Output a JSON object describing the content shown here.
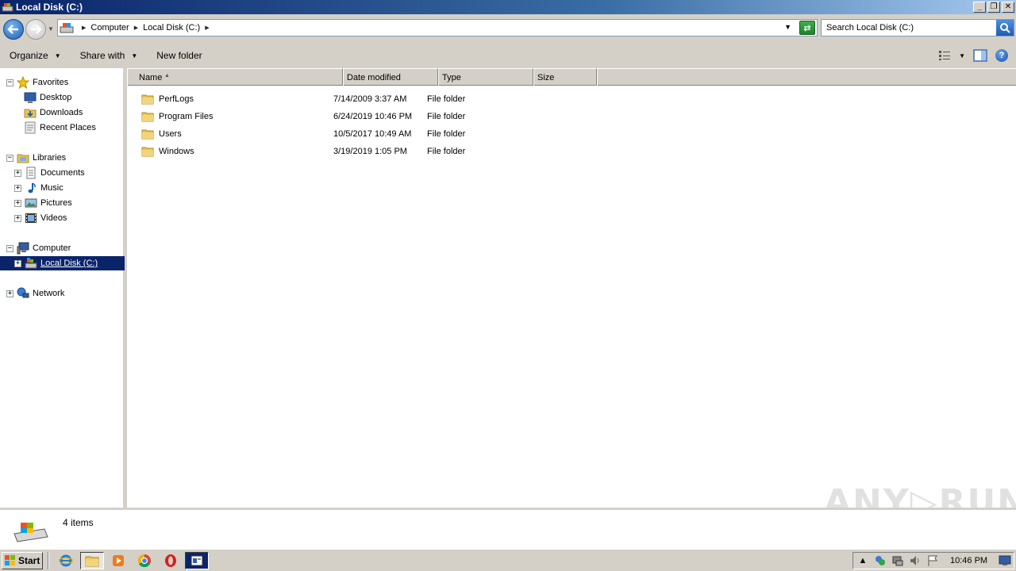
{
  "window": {
    "title": "Local Disk (C:)",
    "minimize_label": "_",
    "restore_label": "❐",
    "close_label": "✕"
  },
  "address": {
    "crumbs": [
      "Computer",
      "Local Disk (C:)"
    ],
    "separator": "▶"
  },
  "search": {
    "placeholder": "Search Local Disk (C:)"
  },
  "toolbar": {
    "organize": "Organize",
    "share_with": "Share with",
    "new_folder": "New folder",
    "help": "?"
  },
  "nav": {
    "favorites": "Favorites",
    "desktop": "Desktop",
    "downloads": "Downloads",
    "recent_places": "Recent Places",
    "libraries": "Libraries",
    "documents": "Documents",
    "music": "Music",
    "pictures": "Pictures",
    "videos": "Videos",
    "computer": "Computer",
    "local_disk": "Local Disk (C:)",
    "network": "Network",
    "collapse": "−",
    "expand": "+"
  },
  "columns": {
    "name": "Name",
    "date_modified": "Date modified",
    "type": "Type",
    "size": "Size"
  },
  "files": [
    {
      "name": "PerfLogs",
      "date": "7/14/2009 3:37 AM",
      "type": "File folder"
    },
    {
      "name": "Program Files",
      "date": "6/24/2019 10:46 PM",
      "type": "File folder"
    },
    {
      "name": "Users",
      "date": "10/5/2017 10:49 AM",
      "type": "File folder"
    },
    {
      "name": "Windows",
      "date": "3/19/2019 1:05 PM",
      "type": "File folder"
    }
  ],
  "status": {
    "item_count": "4 items"
  },
  "taskbar": {
    "start": "Start",
    "clock": "10:46 PM"
  },
  "watermark": "ANY▷RUN",
  "colors": {
    "selection": "#0a246a",
    "titlebar_start": "#0a246a",
    "folder": "#e8c45a"
  }
}
